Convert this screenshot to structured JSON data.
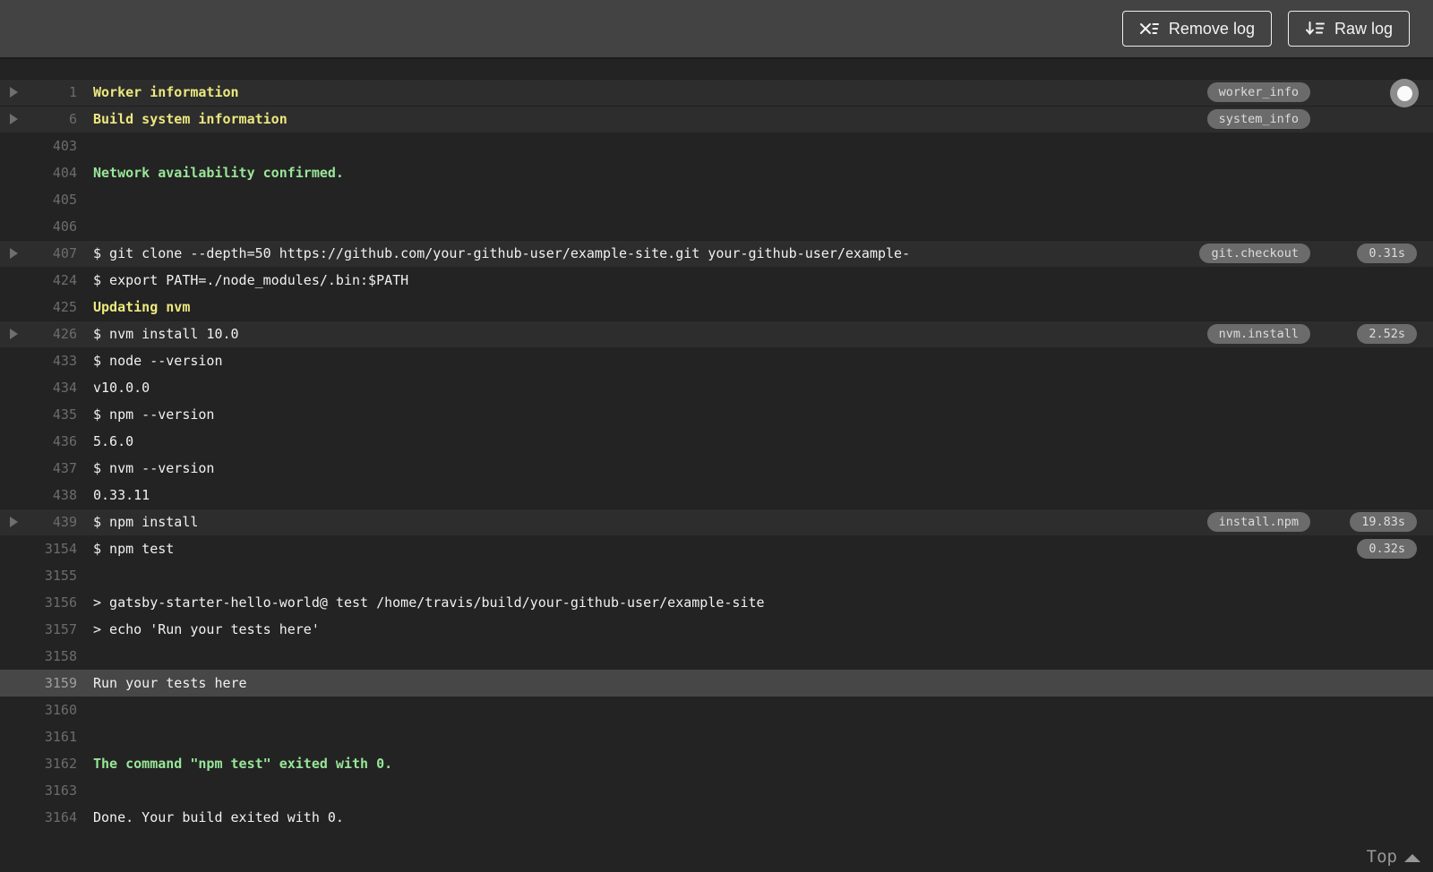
{
  "toolbar": {
    "remove_log_label": "Remove log",
    "raw_log_label": "Raw log"
  },
  "colors": {
    "header_bg": "#434343",
    "log_bg": "#232323",
    "fold_row_bg": "#2d2d2d",
    "selected_row_bg": "#474747",
    "section_yellow": "#ede87e",
    "success_green": "#99e699",
    "badge_bg": "#6b6b6b",
    "text": "#f1f1f1",
    "line_number": "#6c6c6c"
  },
  "log": {
    "rows": [
      {
        "num": "1",
        "text": "Worker information",
        "style": "section",
        "fold": true,
        "badge": "worker_info"
      },
      {
        "num": "6",
        "text": "Build system information",
        "style": "section",
        "fold": true,
        "badge": "system_info"
      },
      {
        "num": "403",
        "text": ""
      },
      {
        "num": "404",
        "text": "Network availability confirmed.",
        "style": "success"
      },
      {
        "num": "405",
        "text": ""
      },
      {
        "num": "406",
        "text": ""
      },
      {
        "num": "407",
        "text": "$ git clone --depth=50 https://github.com/your-github-user/example-site.git your-github-user/example-",
        "fold": true,
        "badge": "git.checkout",
        "time": "0.31s"
      },
      {
        "num": "424",
        "text": "$ export PATH=./node_modules/.bin:$PATH"
      },
      {
        "num": "425",
        "text": "Updating nvm",
        "style": "section"
      },
      {
        "num": "426",
        "text": "$ nvm install 10.0",
        "fold": true,
        "badge": "nvm.install",
        "time": "2.52s"
      },
      {
        "num": "433",
        "text": "$ node --version"
      },
      {
        "num": "434",
        "text": "v10.0.0"
      },
      {
        "num": "435",
        "text": "$ npm --version"
      },
      {
        "num": "436",
        "text": "5.6.0"
      },
      {
        "num": "437",
        "text": "$ nvm --version"
      },
      {
        "num": "438",
        "text": "0.33.11"
      },
      {
        "num": "439",
        "text": "$ npm install",
        "fold": true,
        "badge": "install.npm",
        "time": "19.83s"
      },
      {
        "num": "3154",
        "text": "$ npm test",
        "time": "0.32s"
      },
      {
        "num": "3155",
        "text": ""
      },
      {
        "num": "3156",
        "text": "> gatsby-starter-hello-world@ test /home/travis/build/your-github-user/example-site"
      },
      {
        "num": "3157",
        "text": "> echo 'Run your tests here'"
      },
      {
        "num": "3158",
        "text": ""
      },
      {
        "num": "3159",
        "text": "Run your tests here",
        "selected": true
      },
      {
        "num": "3160",
        "text": ""
      },
      {
        "num": "3161",
        "text": ""
      },
      {
        "num": "3162",
        "text": "The command \"npm test\" exited with 0.",
        "style": "success"
      },
      {
        "num": "3163",
        "text": ""
      },
      {
        "num": "3164",
        "text": "Done. Your build exited with 0."
      }
    ]
  },
  "footer": {
    "top_label": "Top"
  }
}
